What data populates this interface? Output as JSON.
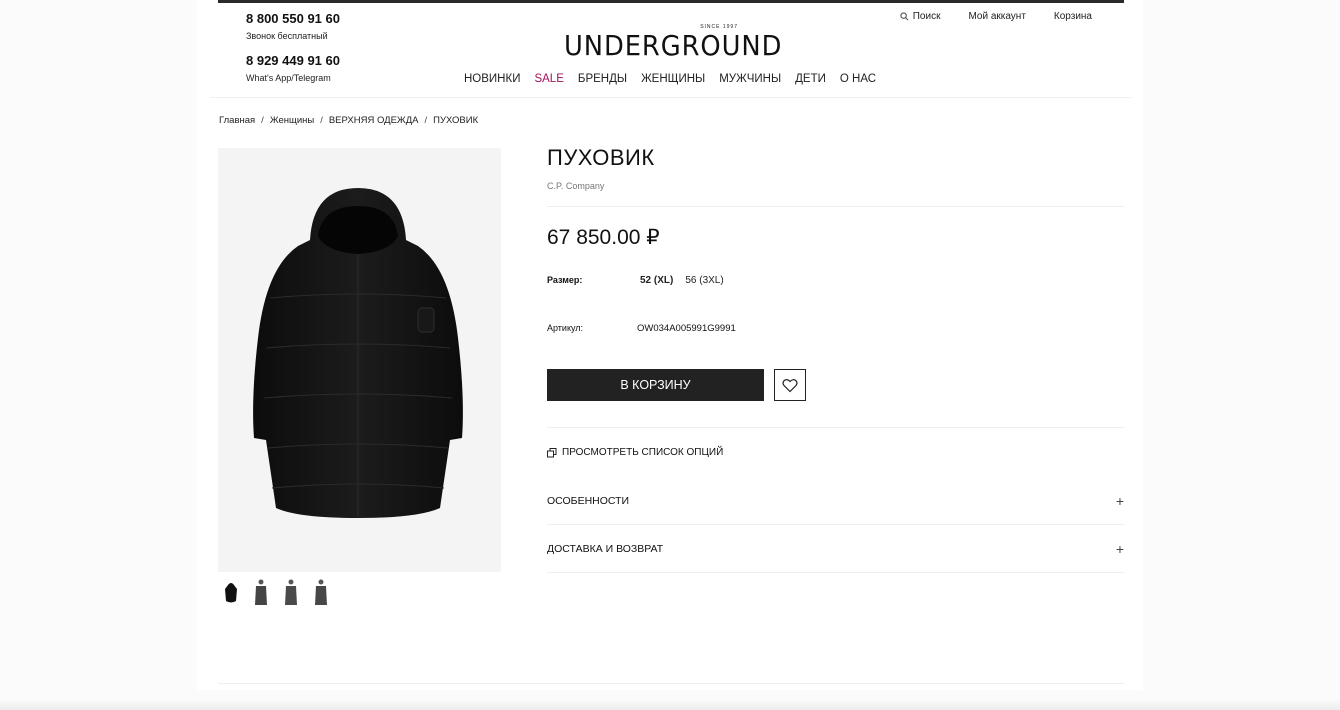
{
  "header": {
    "phone1": "8 800 550 91 60",
    "phone1_note": "Звонок бесплатный",
    "phone2": "8 929 449 91 60",
    "phone2_note": "What's App/Telegram",
    "logo_since": "SINCE 1997",
    "logo": "UNDERGROUND",
    "search_label": "Поиск",
    "account_label": "Мой аккаунт",
    "cart_label": "Корзина",
    "nav": [
      "НОВИНКИ",
      "SALE",
      "БРЕНДЫ",
      "ЖЕНЩИНЫ",
      "МУЖЧИНЫ",
      "ДЕТИ",
      "О НАС"
    ],
    "accent_color": "#a3115d"
  },
  "breadcrumb": [
    "Главная",
    "Женщины",
    "ВЕРХНЯЯ ОДЕЖДА",
    "ПУХОВИК"
  ],
  "product": {
    "title": "ПУХОВИК",
    "brand": "C.P. Company",
    "price": "67 850.00 ₽",
    "size_label": "Размер:",
    "sizes": [
      "52 (XL)",
      "56 (3XL)"
    ],
    "selected_size": "52 (XL)",
    "sku_label": "Артикул:",
    "sku": "OW034A005991G9991",
    "add_to_cart": "В КОРЗИНУ",
    "options_link": "ПРОСМОТРЕТЬ СПИСОК ОПЦИЙ",
    "accordion": [
      "ОСОБЕННОСТИ",
      "ДОСТАВКА И ВОЗВРАТ"
    ],
    "thumbnail_count": 4
  }
}
